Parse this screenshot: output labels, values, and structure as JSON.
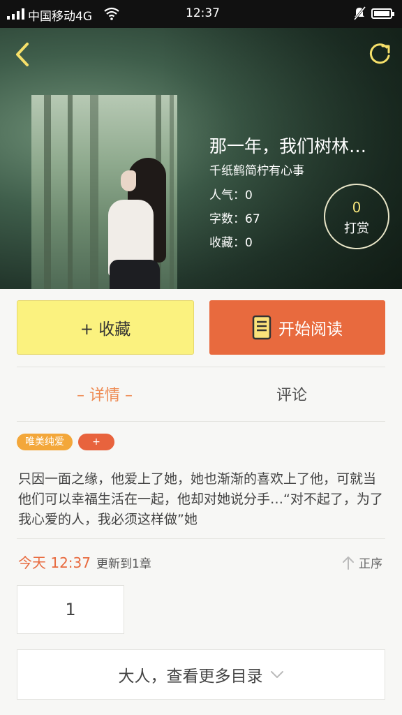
{
  "status_bar": {
    "carrier": "中国移动4G",
    "time": "12:37"
  },
  "book": {
    "title": "那一年，我们树林…",
    "author": "千纸鹤简柠有心事",
    "stats": {
      "popularity": "人气：0",
      "words": "字数：67",
      "favorites": "收藏：0"
    },
    "tip": {
      "count": "0",
      "label": "打赏"
    }
  },
  "actions": {
    "favorite_label": "+ 收藏",
    "read_label": "开始阅读"
  },
  "tabs": [
    {
      "label": "– 详情 –",
      "active": true
    },
    {
      "label": "评论",
      "active": false
    }
  ],
  "tags": {
    "genre": "唯美纯爱",
    "add": "+"
  },
  "synopsis": "只因一面之缘，他爱上了她，她也渐渐的喜欢上了他，可就当他们可以幸福生活在一起，他却对她说分手…“对不起了，为了我心爱的人，我必须这样做”她",
  "update": {
    "time": "今天 12:37",
    "text": "更新到1章",
    "sort_label": "正序"
  },
  "chapters": [
    "1"
  ],
  "more_catalog_label": "大人，查看更多目录",
  "colors": {
    "accent_orange": "#e86a3e",
    "favorite_yellow": "#fbf27f",
    "tab_active": "#ee8a52",
    "tag_genre": "#f3a73a"
  }
}
